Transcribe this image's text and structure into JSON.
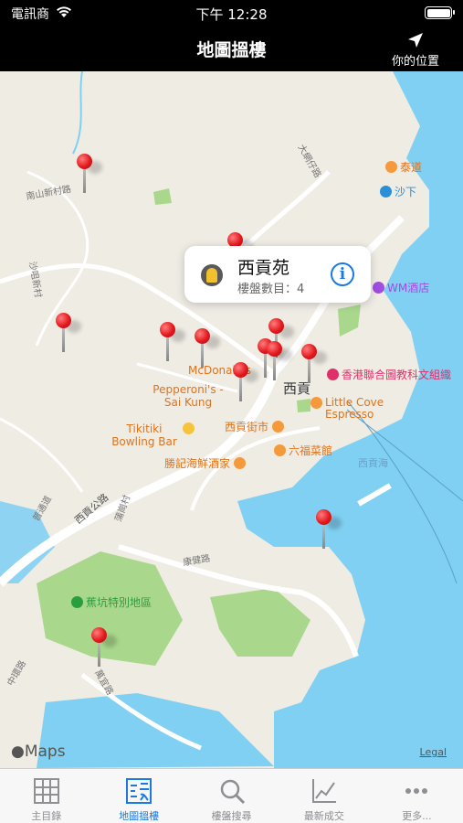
{
  "status_bar": {
    "carrier": "電訊商",
    "time": "下午 12:28"
  },
  "nav": {
    "title": "地圖搵樓",
    "location_button": "你的位置"
  },
  "callout": {
    "name": "西貢苑",
    "count_label": "樓盤數目：4"
  },
  "map_labels": {
    "poi": [
      {
        "text": "泰道",
        "color": "orange"
      },
      {
        "text": "沙下",
        "color": "blue"
      },
      {
        "text": "WM酒店",
        "color": "purple"
      },
      {
        "text": "香港聯合圖教科文組織",
        "color": "pink"
      },
      {
        "text": "McDonald's",
        "color": "orange"
      },
      {
        "text": "Pepperoni's - Sai Kung",
        "color": "orange"
      },
      {
        "text": "西貢",
        "color": "dark"
      },
      {
        "text": "Little Cove Espresso",
        "color": "orange"
      },
      {
        "text": "Tikitiki Bowling Bar",
        "color": "orange"
      },
      {
        "text": "西貢街市",
        "color": "orange"
      },
      {
        "text": "勝記海鮮酒家",
        "color": "orange"
      },
      {
        "text": "六福菜館",
        "color": "orange"
      },
      {
        "text": "西貢海",
        "color": "water"
      },
      {
        "text": "蕉坑特別地區",
        "color": "green"
      }
    ],
    "roads": [
      "南山新村路",
      "大網仔路",
      "西貢公路",
      "康健路",
      "普通道",
      "萬宜路",
      "蒲崗村",
      "沙咀新村",
      "中環路"
    ]
  },
  "map_footer": {
    "logo": "Maps",
    "legal": "Legal"
  },
  "tabs": [
    {
      "label": "主目錄",
      "icon": "grid-icon",
      "active": false
    },
    {
      "label": "地圖搵樓",
      "icon": "map-search-icon",
      "active": true
    },
    {
      "label": "樓盤搜尋",
      "icon": "magnifier-icon",
      "active": false
    },
    {
      "label": "最新成交",
      "icon": "line-chart-icon",
      "active": false
    },
    {
      "label": "更多...",
      "icon": "more-dots-icon",
      "active": false
    }
  ],
  "colors": {
    "accent": "#1a7ae0",
    "pin": "#e3191e",
    "water": "#7fd0f2",
    "park": "#a9d88c"
  }
}
